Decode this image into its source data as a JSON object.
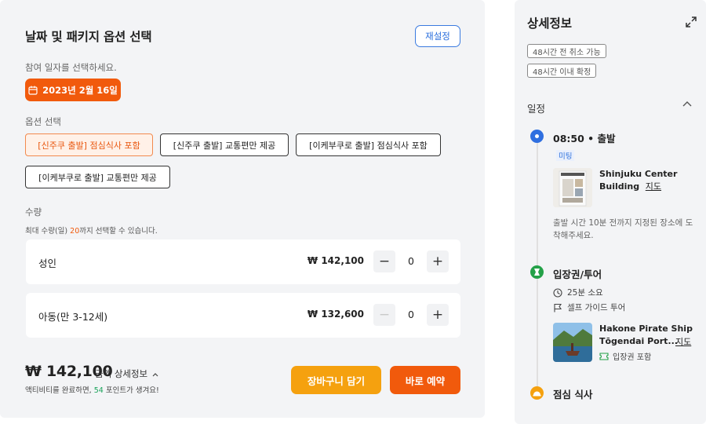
{
  "options_panel": {
    "title": "날짜 및 패키지 옵션 선택",
    "reset_label": "재설정",
    "date_prompt": "참여 일자를 선택하세요.",
    "selected_date": "2023년 2월 16일",
    "option_heading": "옵션 선택",
    "options": [
      {
        "label": "[신주쿠 출발] 점심식사 포함",
        "selected": true
      },
      {
        "label": "[신주쿠 출발] 교통편만 제공",
        "selected": false
      },
      {
        "label": "[이케부쿠로 출발] 점심식사 포함",
        "selected": false
      },
      {
        "label": "[이케부쿠로 출발] 교통편만 제공",
        "selected": false
      }
    ],
    "quantity_heading": "수량",
    "quantity_note_prefix": "최대 수량(일) ",
    "quantity_max": "20",
    "quantity_note_suffix": "까지 선택할 수 있습니다.",
    "tickets": [
      {
        "name": "성인",
        "price": "₩ 142,100",
        "count": "0"
      },
      {
        "name": "아동(만 3-12세)",
        "price": "₩ 132,600",
        "count": "0"
      }
    ],
    "total": "₩ 142,100",
    "detail_toggle": "금액 상세정보",
    "points_prefix": "액티비티를 완료하면, ",
    "points_value": "54",
    "points_suffix": " 포인트가 생겨요!",
    "cart_label": "장바구니 담기",
    "buy_label": "바로 예약"
  },
  "details_panel": {
    "title": "상세정보",
    "tags": [
      "48시간 전 취소 가능",
      "48시간 이내 확정"
    ],
    "schedule_heading": "일정",
    "departure_time": "08:50 • 출발",
    "meeting_badge": "미팅",
    "departure_place_line1": "Shinjuku Center",
    "departure_place_line2": "Building",
    "map_label": "지도",
    "departure_note": "출발 시간 10분 전까지 지정된 장소에 도착해주세요.",
    "tour_title": "입장권/투어",
    "tour_duration": "25분 소요",
    "tour_type": "셀프 가이드 투어",
    "tour_place_line1": "Hakone Pirate Ship",
    "tour_place_line2": "Tōgendai Port...",
    "ticket_included": "입장권 포함",
    "lunch_title": "점심 식사"
  },
  "colors": {
    "accent_orange": "#f15a0c",
    "cart_yellow": "#f5a10f",
    "link_blue": "#2b6fdd",
    "green": "#24a148"
  }
}
